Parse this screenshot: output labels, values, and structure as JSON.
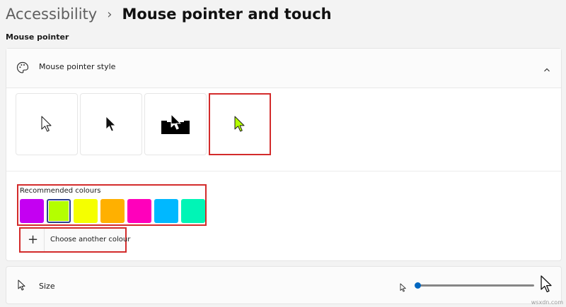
{
  "breadcrumb": {
    "parent": "Accessibility",
    "separator": "›",
    "current": "Mouse pointer and touch"
  },
  "section_label": "Mouse pointer",
  "pointer_style": {
    "title": "Mouse pointer style",
    "icon": "palette-icon",
    "expanded": true,
    "options": [
      {
        "name": "white",
        "selected": false
      },
      {
        "name": "black",
        "selected": false
      },
      {
        "name": "inverted",
        "selected": false
      },
      {
        "name": "custom",
        "selected": true
      }
    ]
  },
  "recommended": {
    "label": "Recommended colours",
    "colors": [
      "#c400f2",
      "#b4ff00",
      "#f5ff00",
      "#ffb000",
      "#ff00bb",
      "#00b8ff",
      "#00f5b6"
    ],
    "selected_index": 1
  },
  "choose_color": {
    "icon": "plus-icon",
    "label": "Choose another colour"
  },
  "size": {
    "label": "Size",
    "value": 1
  },
  "watermark": "wsxdn.com"
}
